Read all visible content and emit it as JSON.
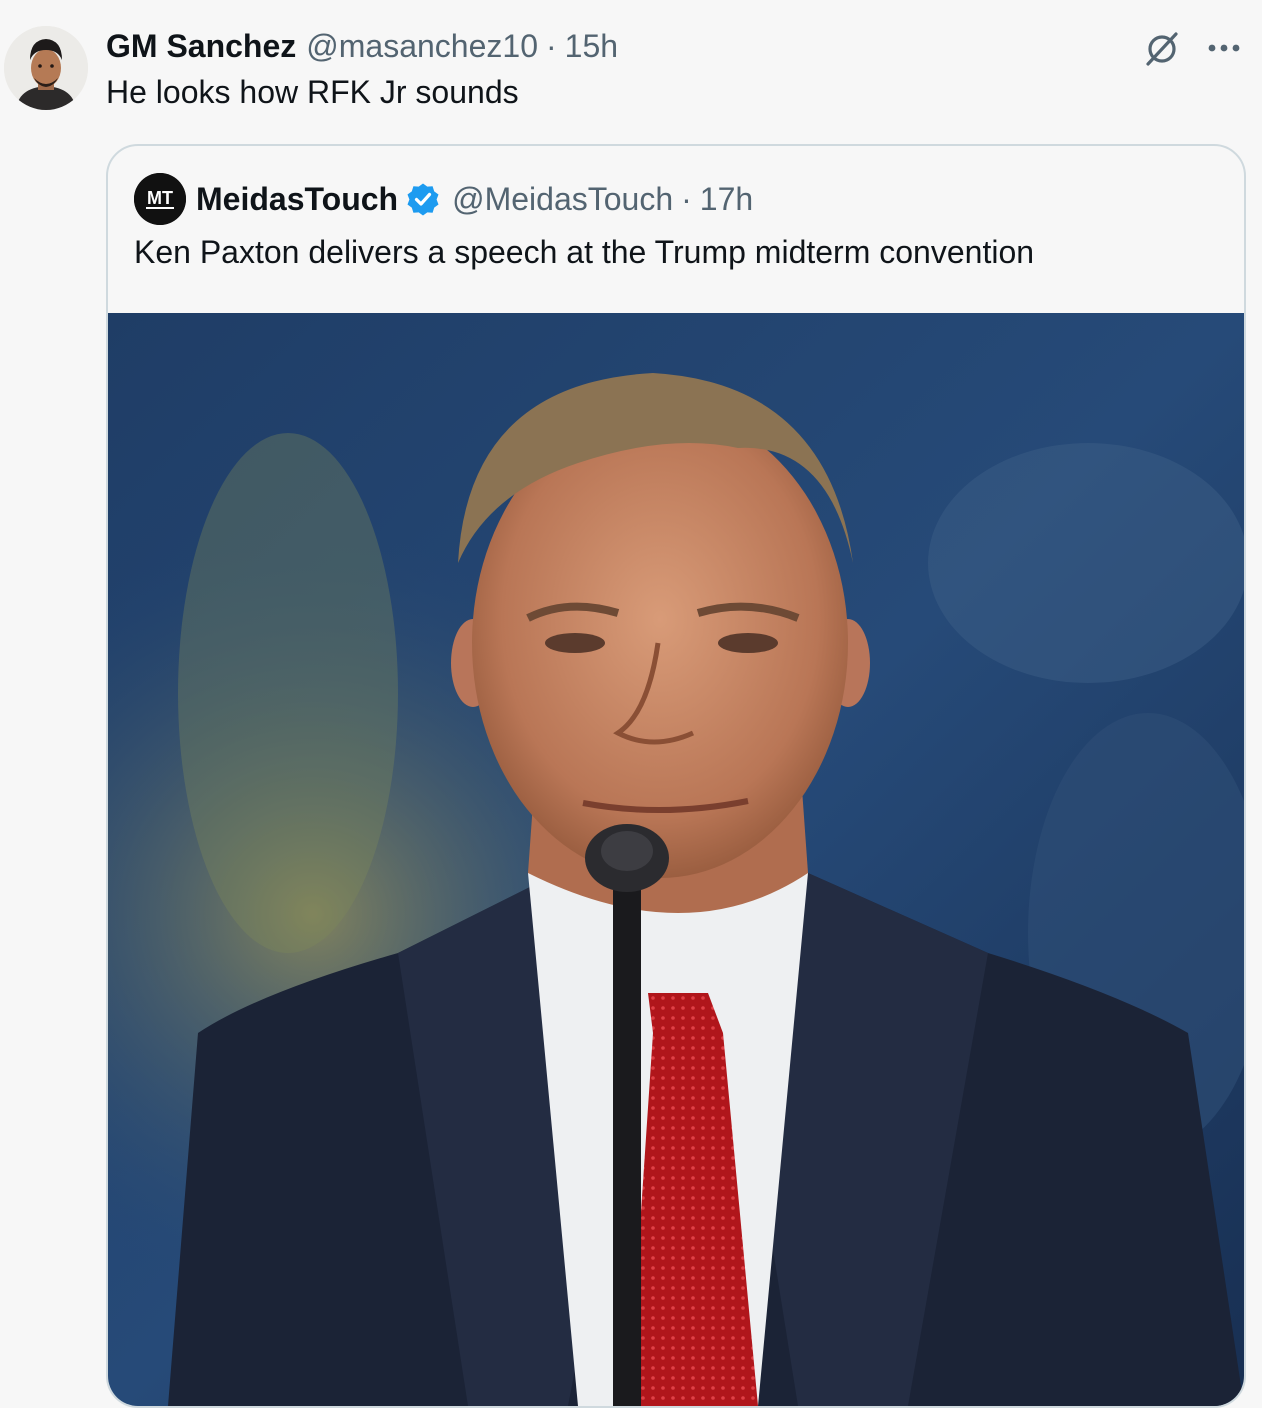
{
  "tweet": {
    "author_name": "GM Sanchez",
    "author_handle": "@masanchez10",
    "separator": "·",
    "time": "15h",
    "text": "He looks how RFK Jr sounds",
    "avatar_icon": "profile-photo",
    "actions": {
      "grok_icon": "grok-icon",
      "more_icon": "more-options-icon"
    }
  },
  "quoted": {
    "author_name": "MeidasTouch",
    "author_handle": "@MeidasTouch",
    "separator": "·",
    "time": "17h",
    "avatar_text": "MT",
    "verified_icon": "verified-badge-icon",
    "verified_color": "#1d9bf0",
    "text": "Ken Paxton delivers a speech at the Trump midterm convention",
    "media_description": "man speaking at microphone"
  },
  "colors": {
    "background": "#f7f7f7",
    "text_primary": "#0f1419",
    "text_secondary": "#536471",
    "border": "#cfd9de"
  }
}
